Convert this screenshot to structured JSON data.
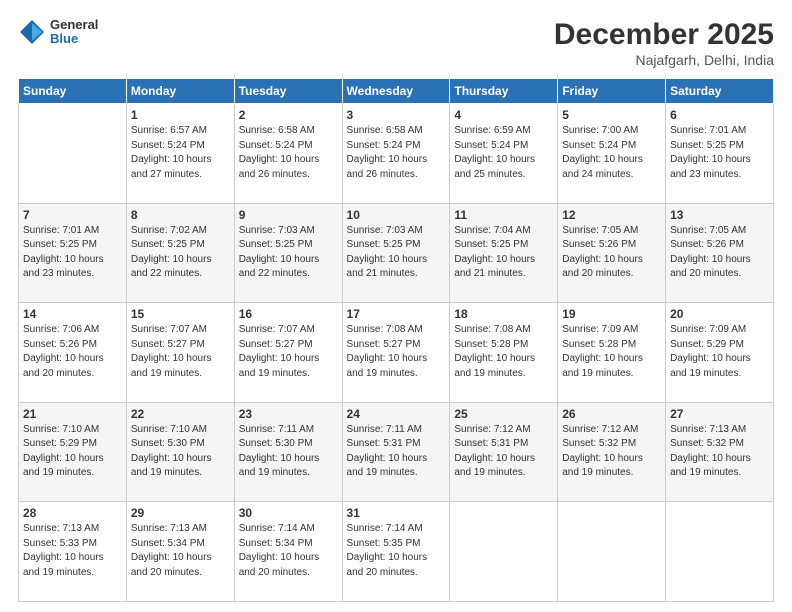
{
  "logo": {
    "general": "General",
    "blue": "Blue"
  },
  "title": "December 2025",
  "subtitle": "Najafgarh, Delhi, India",
  "days_header": [
    "Sunday",
    "Monday",
    "Tuesday",
    "Wednesday",
    "Thursday",
    "Friday",
    "Saturday"
  ],
  "weeks": [
    [
      {
        "num": "",
        "info": ""
      },
      {
        "num": "1",
        "info": "Sunrise: 6:57 AM\nSunset: 5:24 PM\nDaylight: 10 hours\nand 27 minutes."
      },
      {
        "num": "2",
        "info": "Sunrise: 6:58 AM\nSunset: 5:24 PM\nDaylight: 10 hours\nand 26 minutes."
      },
      {
        "num": "3",
        "info": "Sunrise: 6:58 AM\nSunset: 5:24 PM\nDaylight: 10 hours\nand 26 minutes."
      },
      {
        "num": "4",
        "info": "Sunrise: 6:59 AM\nSunset: 5:24 PM\nDaylight: 10 hours\nand 25 minutes."
      },
      {
        "num": "5",
        "info": "Sunrise: 7:00 AM\nSunset: 5:24 PM\nDaylight: 10 hours\nand 24 minutes."
      },
      {
        "num": "6",
        "info": "Sunrise: 7:01 AM\nSunset: 5:25 PM\nDaylight: 10 hours\nand 23 minutes."
      }
    ],
    [
      {
        "num": "7",
        "info": "Sunrise: 7:01 AM\nSunset: 5:25 PM\nDaylight: 10 hours\nand 23 minutes."
      },
      {
        "num": "8",
        "info": "Sunrise: 7:02 AM\nSunset: 5:25 PM\nDaylight: 10 hours\nand 22 minutes."
      },
      {
        "num": "9",
        "info": "Sunrise: 7:03 AM\nSunset: 5:25 PM\nDaylight: 10 hours\nand 22 minutes."
      },
      {
        "num": "10",
        "info": "Sunrise: 7:03 AM\nSunset: 5:25 PM\nDaylight: 10 hours\nand 21 minutes."
      },
      {
        "num": "11",
        "info": "Sunrise: 7:04 AM\nSunset: 5:25 PM\nDaylight: 10 hours\nand 21 minutes."
      },
      {
        "num": "12",
        "info": "Sunrise: 7:05 AM\nSunset: 5:26 PM\nDaylight: 10 hours\nand 20 minutes."
      },
      {
        "num": "13",
        "info": "Sunrise: 7:05 AM\nSunset: 5:26 PM\nDaylight: 10 hours\nand 20 minutes."
      }
    ],
    [
      {
        "num": "14",
        "info": "Sunrise: 7:06 AM\nSunset: 5:26 PM\nDaylight: 10 hours\nand 20 minutes."
      },
      {
        "num": "15",
        "info": "Sunrise: 7:07 AM\nSunset: 5:27 PM\nDaylight: 10 hours\nand 19 minutes."
      },
      {
        "num": "16",
        "info": "Sunrise: 7:07 AM\nSunset: 5:27 PM\nDaylight: 10 hours\nand 19 minutes."
      },
      {
        "num": "17",
        "info": "Sunrise: 7:08 AM\nSunset: 5:27 PM\nDaylight: 10 hours\nand 19 minutes."
      },
      {
        "num": "18",
        "info": "Sunrise: 7:08 AM\nSunset: 5:28 PM\nDaylight: 10 hours\nand 19 minutes."
      },
      {
        "num": "19",
        "info": "Sunrise: 7:09 AM\nSunset: 5:28 PM\nDaylight: 10 hours\nand 19 minutes."
      },
      {
        "num": "20",
        "info": "Sunrise: 7:09 AM\nSunset: 5:29 PM\nDaylight: 10 hours\nand 19 minutes."
      }
    ],
    [
      {
        "num": "21",
        "info": "Sunrise: 7:10 AM\nSunset: 5:29 PM\nDaylight: 10 hours\nand 19 minutes."
      },
      {
        "num": "22",
        "info": "Sunrise: 7:10 AM\nSunset: 5:30 PM\nDaylight: 10 hours\nand 19 minutes."
      },
      {
        "num": "23",
        "info": "Sunrise: 7:11 AM\nSunset: 5:30 PM\nDaylight: 10 hours\nand 19 minutes."
      },
      {
        "num": "24",
        "info": "Sunrise: 7:11 AM\nSunset: 5:31 PM\nDaylight: 10 hours\nand 19 minutes."
      },
      {
        "num": "25",
        "info": "Sunrise: 7:12 AM\nSunset: 5:31 PM\nDaylight: 10 hours\nand 19 minutes."
      },
      {
        "num": "26",
        "info": "Sunrise: 7:12 AM\nSunset: 5:32 PM\nDaylight: 10 hours\nand 19 minutes."
      },
      {
        "num": "27",
        "info": "Sunrise: 7:13 AM\nSunset: 5:32 PM\nDaylight: 10 hours\nand 19 minutes."
      }
    ],
    [
      {
        "num": "28",
        "info": "Sunrise: 7:13 AM\nSunset: 5:33 PM\nDaylight: 10 hours\nand 19 minutes."
      },
      {
        "num": "29",
        "info": "Sunrise: 7:13 AM\nSunset: 5:34 PM\nDaylight: 10 hours\nand 20 minutes."
      },
      {
        "num": "30",
        "info": "Sunrise: 7:14 AM\nSunset: 5:34 PM\nDaylight: 10 hours\nand 20 minutes."
      },
      {
        "num": "31",
        "info": "Sunrise: 7:14 AM\nSunset: 5:35 PM\nDaylight: 10 hours\nand 20 minutes."
      },
      {
        "num": "",
        "info": ""
      },
      {
        "num": "",
        "info": ""
      },
      {
        "num": "",
        "info": ""
      }
    ]
  ]
}
